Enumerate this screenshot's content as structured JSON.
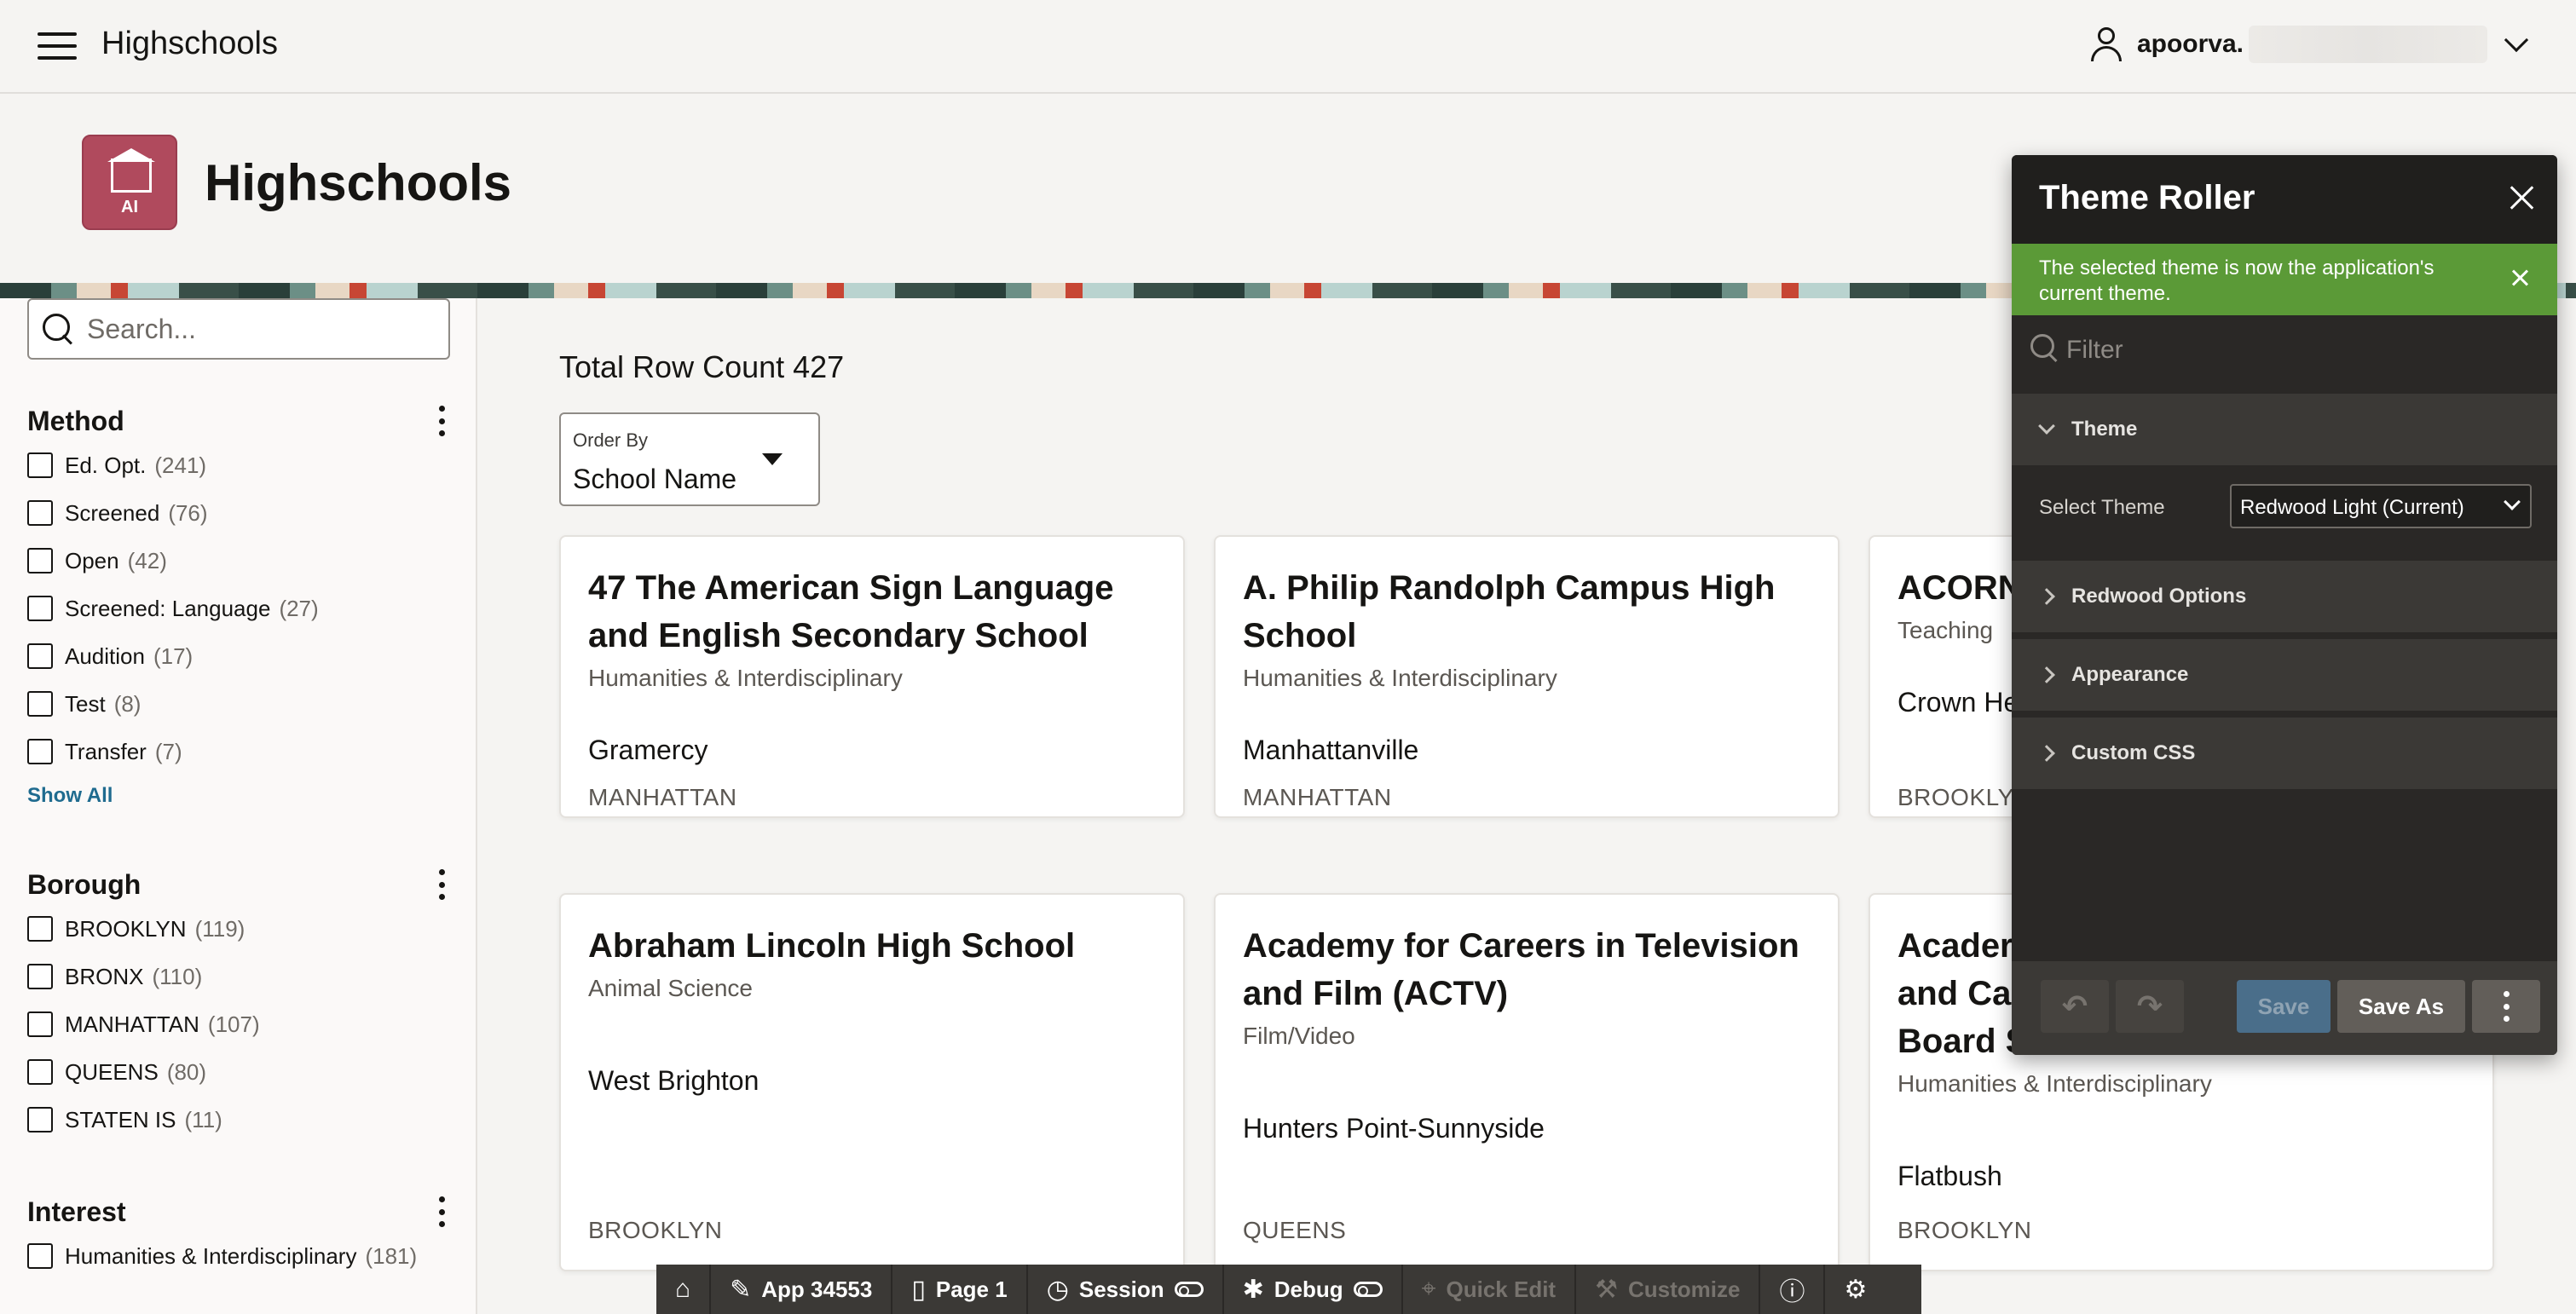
{
  "topbar": {
    "app_title": "Highschools",
    "username": "apoorva."
  },
  "hero": {
    "title": "Highschools",
    "logo_text": "AI"
  },
  "sidebar": {
    "search_placeholder": "Search...",
    "facets": [
      {
        "title": "Method",
        "items": [
          {
            "label": "Ed. Opt.",
            "count": "(241)"
          },
          {
            "label": "Screened",
            "count": "(76)"
          },
          {
            "label": "Open",
            "count": "(42)"
          },
          {
            "label": "Screened: Language",
            "count": "(27)"
          },
          {
            "label": "Audition",
            "count": "(17)"
          },
          {
            "label": "Test",
            "count": "(8)"
          },
          {
            "label": "Transfer",
            "count": "(7)"
          }
        ],
        "show_all": "Show All"
      },
      {
        "title": "Borough",
        "items": [
          {
            "label": "BROOKLYN",
            "count": "(119)"
          },
          {
            "label": "BRONX",
            "count": "(110)"
          },
          {
            "label": "MANHATTAN",
            "count": "(107)"
          },
          {
            "label": "QUEENS",
            "count": "(80)"
          },
          {
            "label": "STATEN IS",
            "count": "(11)"
          }
        ]
      },
      {
        "title": "Interest",
        "items": [
          {
            "label": "Humanities & Interdisciplinary",
            "count": "(181)"
          }
        ]
      }
    ]
  },
  "main": {
    "row_count": "Total Row Count 427",
    "order_by": {
      "label": "Order By",
      "value": "School Name"
    },
    "cards": [
      {
        "title": "47 The American Sign Language and English Secondary School",
        "interest": "Humanities & Interdisciplinary",
        "neighborhood": "Gramercy",
        "borough": "MANHATTAN"
      },
      {
        "title": "A. Philip Randolph Campus High School",
        "interest": "Humanities & Interdisciplinary",
        "neighborhood": "Manhattanville",
        "borough": "MANHATTAN"
      },
      {
        "title": "ACORN",
        "interest": "Teaching",
        "neighborhood": "Crown He",
        "borough": "BROOKLYN"
      },
      {
        "title": "Abraham Lincoln High School",
        "interest": "Animal Science",
        "neighborhood": "West Brighton",
        "borough": "BROOKLYN"
      },
      {
        "title": "Academy for Careers in Television and Film (ACTV)",
        "interest": "Film/Video",
        "neighborhood": "Hunters Point-Sunnyside",
        "borough": "QUEENS"
      },
      {
        "title": "Acader and Ca Board S",
        "interest": "Humanities & Interdisciplinary",
        "neighborhood": "Flatbush",
        "borough": "BROOKLYN"
      }
    ]
  },
  "theme_roller": {
    "title": "Theme Roller",
    "alert": "The selected theme is now the application's current theme.",
    "filter_placeholder": "Filter",
    "sections": {
      "theme": "Theme",
      "redwood_options": "Redwood Options",
      "appearance": "Appearance",
      "custom_css": "Custom CSS"
    },
    "select_theme_label": "Select Theme",
    "select_theme_value": "Redwood Light (Current)",
    "buttons": {
      "undo": "↶",
      "redo": "↷",
      "save": "Save",
      "save_as": "Save As"
    }
  },
  "devbar": {
    "home": "⌂",
    "app": "App 34553",
    "page": "Page 1",
    "session": "Session",
    "debug": "Debug",
    "quick_edit": "Quick Edit",
    "customize": "Customize",
    "info": "ⓘ",
    "settings": "⚙"
  },
  "colors": {
    "accent_green": "#5b9a37",
    "logo": "#b04a5d",
    "roller_bg": "#2a2826"
  }
}
